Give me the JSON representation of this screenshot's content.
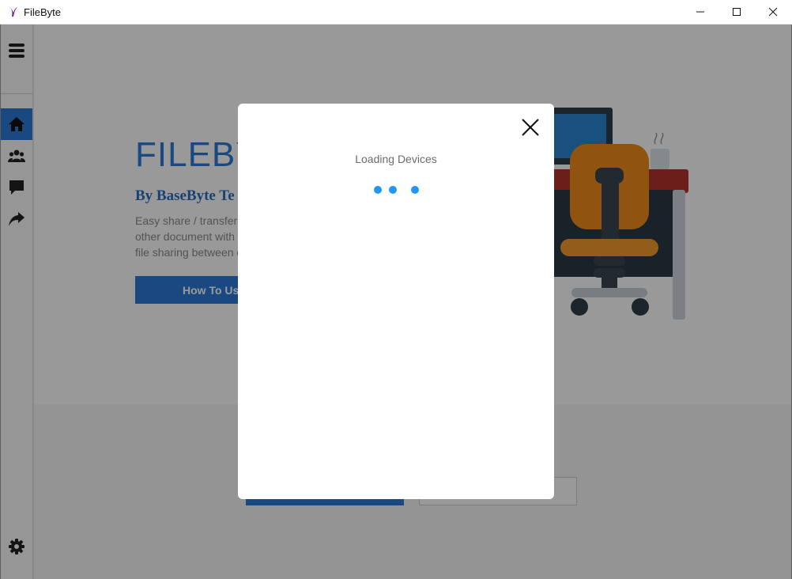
{
  "window": {
    "title": "FileByte",
    "controls": [
      "minimize",
      "maximize",
      "close"
    ]
  },
  "sidebar": {
    "items": [
      {
        "name": "menu",
        "icon": "hamburger-icon"
      },
      {
        "name": "home",
        "icon": "home-icon",
        "active": true
      },
      {
        "name": "community",
        "icon": "users-icon"
      },
      {
        "name": "feedback",
        "icon": "chat-icon"
      },
      {
        "name": "share",
        "icon": "share-icon"
      },
      {
        "name": "settings",
        "icon": "gear-icon"
      }
    ]
  },
  "hero": {
    "title": "FILEBY",
    "byline": "By BaseByte Te",
    "description_lines": [
      "Easy share / transfer p",
      "other document with",
      "file sharing between d"
    ],
    "button_label": "How To Us"
  },
  "modal": {
    "title": "Loading Devices",
    "close_icon": "close-icon",
    "spinner_color": "#2196f3"
  },
  "colors": {
    "accent": "#2a7bd6",
    "overlay": "rgba(0,0,0,0.40)"
  }
}
